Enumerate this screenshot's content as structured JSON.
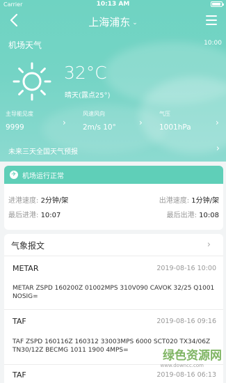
{
  "statusbar": {
    "carrier": "Carrier",
    "time": "10:13 AM"
  },
  "nav": {
    "title": "上海浦东",
    "caret": "⌄"
  },
  "weather": {
    "section_label": "机场天气",
    "update_time": "10:00",
    "temperature": "32°C",
    "condition": "晴天(露点25°)",
    "icon": "sun-icon"
  },
  "metrics": [
    {
      "label": "主导能见度",
      "value": "9999"
    },
    {
      "label": "风速风向",
      "value": "2m/s 10°"
    },
    {
      "label": "气压",
      "value": "1001hPa"
    }
  ],
  "forecast_link": "未来三天全国天气预报",
  "operations": {
    "status": "机场运行正常",
    "arrival_speed_label": "进港速度:",
    "arrival_speed": "2分钟/架",
    "departure_speed_label": "出港速度:",
    "departure_speed": "1分钟/架",
    "last_arrival_label": "最后进港:",
    "last_arrival": "10:07",
    "last_departure_label": "最后出港:",
    "last_departure": "10:08"
  },
  "reports": {
    "title": "气象报文",
    "items": [
      {
        "type": "METAR",
        "time": "2019-08-16 10:00",
        "text": "METAR ZSPD 160200Z 01002MPS 310V090 CAVOK 32/25 Q1001 NOSIG="
      },
      {
        "type": "TAF",
        "time": "2019-08-16 09:16",
        "text": "TAF ZSPD 160116Z 160312 33003MPS 6000 SCT020 TX34/06Z TN30/12Z BECMG  1011 1900 4MPS="
      },
      {
        "type": "TAF",
        "time": "2019-08-16 06:13",
        "text": ""
      }
    ]
  },
  "watermark": {
    "title": "绿色资源网",
    "url": "www.downcc.com"
  },
  "colors": {
    "hero": "#74d4c5",
    "ops_header": "#5fcfb8",
    "background": "#f2f4f5"
  }
}
